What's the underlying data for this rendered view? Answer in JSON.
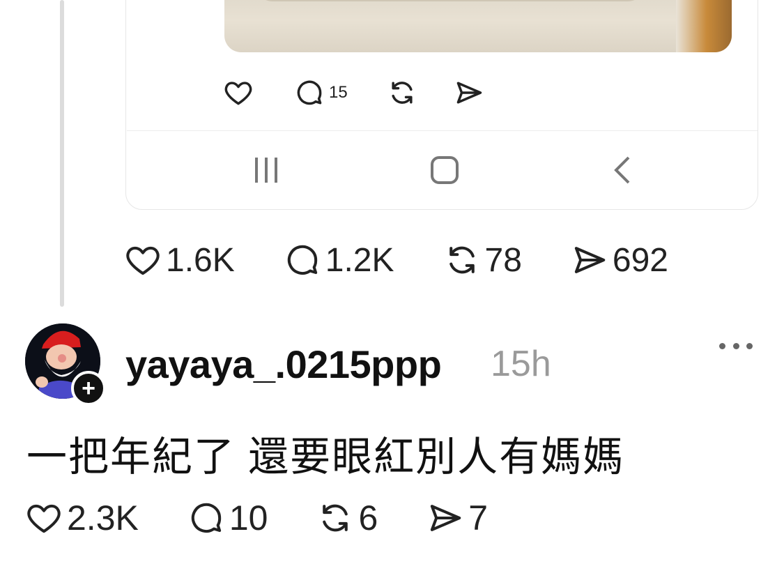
{
  "quoted_post": {
    "actions": {
      "like_icon": "heart-icon",
      "reply_icon": "comment-icon",
      "reply_count": "15",
      "repost_icon": "repost-icon",
      "share_icon": "send-icon"
    },
    "system_nav": [
      "recent-apps-icon",
      "home-icon",
      "back-icon"
    ]
  },
  "parent_stats": {
    "likes": "1.6K",
    "replies": "1.2K",
    "reposts": "78",
    "shares": "692"
  },
  "post": {
    "username": "yayaya_.0215ppp",
    "time": "15h",
    "text": "一把年紀了 還要眼紅別人有媽媽",
    "stats": {
      "likes": "2.3K",
      "replies": "10",
      "reposts": "6",
      "shares": "7"
    }
  },
  "colors": {
    "text": "#111111",
    "muted": "#9a9a9a",
    "divider": "#e6e6e6",
    "thread_line": "#dcdcdc"
  }
}
